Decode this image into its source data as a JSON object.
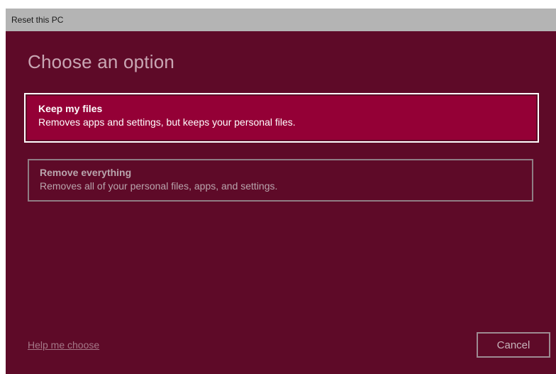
{
  "window": {
    "title": "Reset this PC"
  },
  "main": {
    "heading": "Choose an option",
    "options": [
      {
        "title": "Keep my files",
        "description": "Removes apps and settings, but keeps your personal files.",
        "selected": true
      },
      {
        "title": "Remove everything",
        "description": "Removes all of your personal files, apps, and settings.",
        "selected": false
      }
    ]
  },
  "footer": {
    "help_link": "Help me choose",
    "cancel_label": "Cancel"
  },
  "colors": {
    "background": "#5e0a28",
    "selected_option": "#940036",
    "titlebar": "#b4b4b4"
  }
}
